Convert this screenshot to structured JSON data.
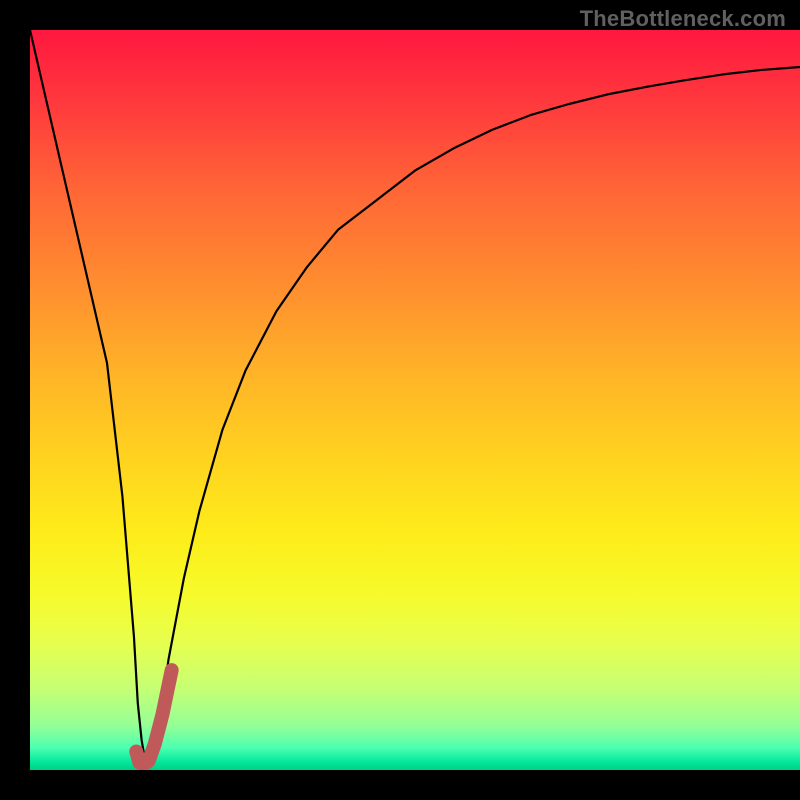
{
  "watermark": "TheBottleneck.com",
  "colors": {
    "frame": "#000000",
    "curve": "#000000",
    "accent": "#c05a5a"
  },
  "chart_data": {
    "type": "line",
    "title": "",
    "xlabel": "",
    "ylabel": "",
    "xlim": [
      0,
      100
    ],
    "ylim": [
      0,
      100
    ],
    "grid": false,
    "legend": false,
    "series": [
      {
        "name": "bottleneck-curve",
        "x": [
          0,
          2,
          4,
          6,
          8,
          10,
          12,
          13.5,
          14,
          14.5,
          15,
          16,
          17,
          18,
          20,
          22,
          25,
          28,
          32,
          36,
          40,
          45,
          50,
          55,
          60,
          65,
          70,
          75,
          80,
          85,
          90,
          95,
          100
        ],
        "y": [
          100,
          91,
          82,
          73,
          64,
          55,
          37,
          18,
          9,
          4,
          1,
          3,
          8,
          15,
          26,
          35,
          46,
          54,
          62,
          68,
          73,
          77,
          81,
          84,
          86.5,
          88.5,
          90,
          91.3,
          92.3,
          93.2,
          94,
          94.6,
          95
        ],
        "color": "#000000"
      },
      {
        "name": "accent-hook",
        "x": [
          13.8,
          14.2,
          14.8,
          15.4,
          16.2,
          17.2,
          18.4
        ],
        "y": [
          2.5,
          1.0,
          0.8,
          1.2,
          3.5,
          7.5,
          13.5
        ],
        "color": "#c05a5a",
        "stroke_width": 14
      }
    ],
    "gradient_stops": [
      {
        "pos": 0,
        "color": "#ff173f"
      },
      {
        "pos": 10,
        "color": "#ff3a3d"
      },
      {
        "pos": 22,
        "color": "#ff6736"
      },
      {
        "pos": 34,
        "color": "#ff8c2f"
      },
      {
        "pos": 46,
        "color": "#ffb228"
      },
      {
        "pos": 58,
        "color": "#ffd31f"
      },
      {
        "pos": 68,
        "color": "#fdec1a"
      },
      {
        "pos": 76,
        "color": "#f7fa2a"
      },
      {
        "pos": 83,
        "color": "#e6ff4f"
      },
      {
        "pos": 89,
        "color": "#c6ff74"
      },
      {
        "pos": 94,
        "color": "#94ff96"
      },
      {
        "pos": 97,
        "color": "#4cffb1"
      },
      {
        "pos": 99,
        "color": "#00e79a"
      },
      {
        "pos": 100,
        "color": "#00cf86"
      }
    ]
  }
}
